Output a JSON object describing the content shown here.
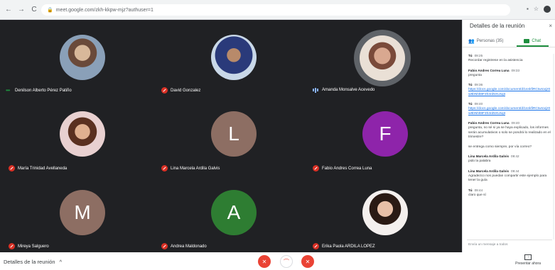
{
  "browser": {
    "url": "meet.google.com/zkh-kkpw-mjz?authuser=1",
    "back_glyph": "←",
    "forward_glyph": "→",
    "reload_glyph": "C",
    "lock_glyph": "🔒"
  },
  "tiles": [
    {
      "name": "Denilson Alberto Pérez Patiño",
      "avatar": "photo",
      "status": "speaking-dots"
    },
    {
      "name": "David Gonzalez",
      "avatar": "photo",
      "status": "muted"
    },
    {
      "name": "Amanda Monsalve Acevedo",
      "avatar": "photo",
      "status": "speaking"
    },
    {
      "name": "María Trinidad Avellaneda",
      "avatar": "photo",
      "status": "muted"
    },
    {
      "name": "Lina Marcela Ardila Galvis",
      "avatar": "letter",
      "letter": "L",
      "color": "#8d6e63",
      "status": "muted"
    },
    {
      "name": "Fabio Andres Correa Luna",
      "avatar": "letter",
      "letter": "F",
      "color": "#8e24aa",
      "status": "muted"
    },
    {
      "name": "Mireya Salguero",
      "avatar": "letter",
      "letter": "M",
      "color": "#8d6e63",
      "status": "muted"
    },
    {
      "name": "Andrea Maldonado",
      "avatar": "letter",
      "letter": "A",
      "color": "#2e7d32",
      "status": "muted"
    },
    {
      "name": "Erika Paola ARDILA LOPEZ",
      "avatar": "photo",
      "status": "muted"
    }
  ],
  "bottom": {
    "meeting_details": "Detalles de la reunión",
    "chevron": "^",
    "present_label": "Presentar ahora",
    "mic_glyph": "🎤",
    "hangup_glyph": "☎",
    "cam_glyph": "⏺"
  },
  "panel": {
    "title": "Detalles de la reunión",
    "close_glyph": "×",
    "tab_people": "Personas (35)",
    "tab_chat": "Chat",
    "input_placeholder": "Envía un mensaje a todos",
    "messages": [
      {
        "sender": "Tú",
        "time": "09:25",
        "text": "Recordar registrese en la asistencia",
        "link": ""
      },
      {
        "sender": "Fabio Andres Correa Luna",
        "time": "09:33",
        "text": "pregunta",
        "link": ""
      },
      {
        "sender": "Tú",
        "time": "09:36",
        "text": "",
        "link": "https://docs.google.com/document/d/1snkfiRCtwIovjz0w8bNhlt8F3h4rd5XUsqit"
      },
      {
        "sender": "Tú",
        "time": "09:40",
        "text": "",
        "link": "https://docs.google.com/document/d/1snkfiRCtwIovjz0w8bNhlt8F3h4rd5XUsqit"
      },
      {
        "sender": "Fabio Andres Correa Luna",
        "time": "09:40",
        "text": "pregunta, no sé si ya se haya explicado, los informes serán acumulativos o solo se pondrá lo realizado en el trimestre?",
        "link": ""
      },
      {
        "sender": "",
        "time": "",
        "text": "se entrega como siempre, por vía correo?",
        "link": ""
      },
      {
        "sender": "Lina Marcela Ardila Galvis",
        "time": "09:42",
        "text": "pido la palabra",
        "link": ""
      },
      {
        "sender": "Lina Marcela Ardila Galvis",
        "time": "09:44",
        "text": "Agradezco nos puedan compartir este ejemplo para tener la guía",
        "link": ""
      },
      {
        "sender": "Tú",
        "time": "09:44",
        "text": "claro que sí",
        "link": ""
      }
    ]
  }
}
